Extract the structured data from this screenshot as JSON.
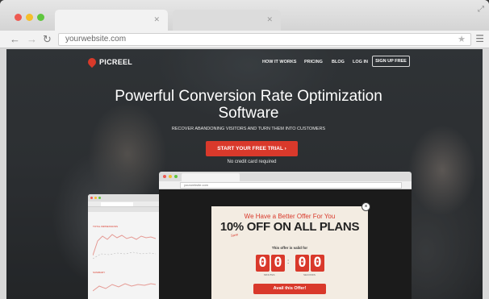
{
  "browser": {
    "url": "yourwebsite.com",
    "window_dots": [
      "#ee5a52",
      "#f5be2b",
      "#5fc63e"
    ]
  },
  "site": {
    "logo": "PICREEL",
    "nav": [
      "HOW IT WORKS",
      "PRICING",
      "BLOG",
      "LOG IN"
    ],
    "signup": "SIGN UP FREE",
    "headline": "Powerful Conversion Rate Optimization Software",
    "subheadline": "RECOVER ABANDONING VISITORS AND TURN THEM INTO CUSTOMERS",
    "cta": "START YOUR FREE TRIAL ›",
    "cta_note": "No credit card required",
    "accent": "#d9392b"
  },
  "inner_browser": {
    "url": "yourwebsite.com"
  },
  "popup": {
    "close": "×",
    "top_line": "We Have a Better Offer For You",
    "headline": "10% OFF ON ALL PLANS",
    "save_tag": "Save",
    "valid_text": "This offer is valid for",
    "minutes": [
      "0",
      "0"
    ],
    "seconds": [
      "0",
      "0"
    ],
    "colon": ":",
    "minutes_label": "MINUTES",
    "seconds_label": "SECONDS",
    "button": "Avail this Offer!"
  },
  "mini_dashboard": {
    "label_top": "TOTAL IMPRESSIONS",
    "label_bottom": "SUMMARY"
  }
}
